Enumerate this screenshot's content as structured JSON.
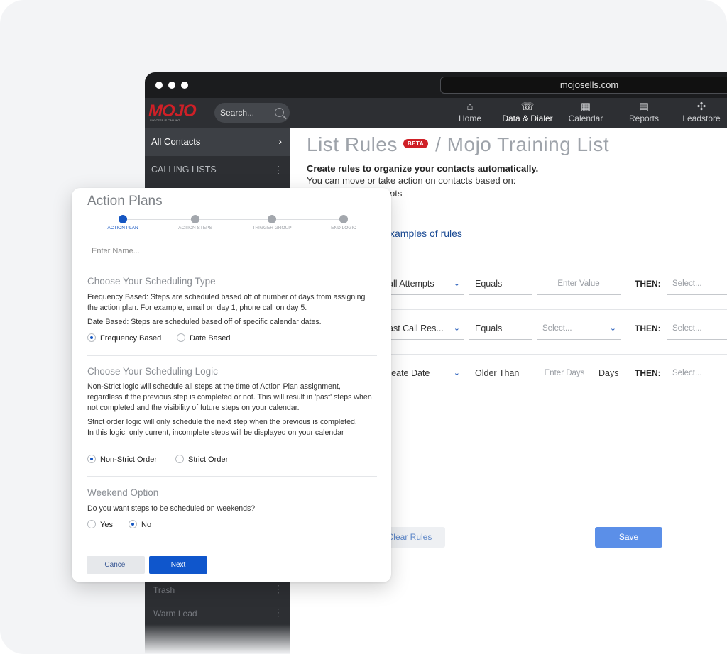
{
  "browser": {
    "url": "mojosells.com"
  },
  "header": {
    "logo_text": "MOJO",
    "logo_tagline": "SUCCESS IS CALLING",
    "search_placeholder": "Search...",
    "nav": [
      {
        "label": "Home",
        "icon": "home-icon",
        "glyph": "⌂",
        "active": false
      },
      {
        "label": "Data & Dialer",
        "icon": "phone-icon",
        "glyph": "☏",
        "active": true
      },
      {
        "label": "Calendar",
        "icon": "calendar-icon",
        "glyph": "▦",
        "active": false
      },
      {
        "label": "Reports",
        "icon": "reports-icon",
        "glyph": "▤",
        "active": false
      },
      {
        "label": "Leadstore",
        "icon": "leadstore-icon",
        "glyph": "✣",
        "active": false
      }
    ]
  },
  "sidebar": {
    "all_contacts": "All Contacts",
    "calling_lists": "CALLING LISTS",
    "bottom_items": [
      "Trash",
      "Warm Lead"
    ]
  },
  "main": {
    "title": "List Rules",
    "beta": "BETA",
    "title_suffix": "/ Mojo Training List",
    "subtitle": "Create rules to organize your contacts automatically.",
    "description": "You can move or take action on contacts based on:",
    "description_partial": "pts",
    "examples_link": "xamples of rules",
    "rules": [
      {
        "field": "all Attempts",
        "operator": "Equals",
        "value": "Enter Value",
        "value_is_placeholder": true,
        "value_dropdown": false,
        "unit": "",
        "then": "THEN:",
        "action": "Select..."
      },
      {
        "field": "ast Call Res...",
        "operator": "Equals",
        "value": "Select...",
        "value_is_placeholder": true,
        "value_dropdown": true,
        "unit": "",
        "then": "THEN:",
        "action": "Select..."
      },
      {
        "field": "reate Date",
        "operator": "Older Than",
        "value": "Enter Days",
        "value_is_placeholder": true,
        "value_dropdown": false,
        "unit": "Days",
        "then": "THEN:",
        "action": "Select..."
      }
    ],
    "clear_button": "Clear Rules",
    "save_button": "Save"
  },
  "modal": {
    "title": "Action Plans",
    "steps": [
      {
        "label": "ACTION PLAN",
        "active": true
      },
      {
        "label": "ACTION STEPS",
        "active": false
      },
      {
        "label": "TRIGGER GROUP",
        "active": false
      },
      {
        "label": "END LOGIC",
        "active": false
      }
    ],
    "name_placeholder": "Enter Name...",
    "scheduling_type": {
      "title": "Choose Your Scheduling Type",
      "p1": "Frequency Based: Steps are scheduled based off of number of days from assigning the action plan. For example, email on day 1, phone call on day 5.",
      "p2": "Date Based: Steps are scheduled based off of specific calendar dates.",
      "options": [
        {
          "label": "Frequency Based",
          "selected": true
        },
        {
          "label": "Date Based",
          "selected": false
        }
      ]
    },
    "scheduling_logic": {
      "title": "Choose Your Scheduling Logic",
      "p1": "Non-Strict logic will schedule all steps at the time of Action Plan assignment, regardless if the previous step is completed or not. This will result in 'past' steps when not completed and the visibility of future steps on your calendar.",
      "p2": "Strict order logic will only schedule the next step when the previous is completed. In this logic, only current, incomplete steps will be displayed on your calendar",
      "options": [
        {
          "label": "Non-Strict Order",
          "selected": true
        },
        {
          "label": "Strict Order",
          "selected": false
        }
      ]
    },
    "weekend": {
      "title": "Weekend Option",
      "question": "Do you want steps to be scheduled on weekends?",
      "options": [
        {
          "label": "Yes",
          "selected": false
        },
        {
          "label": "No",
          "selected": true
        }
      ]
    },
    "cancel_button": "Cancel",
    "next_button": "Next"
  },
  "colors": {
    "brand_red": "#cf2027",
    "primary_blue": "#0f56cc",
    "nav_dark": "#2d2f33"
  }
}
